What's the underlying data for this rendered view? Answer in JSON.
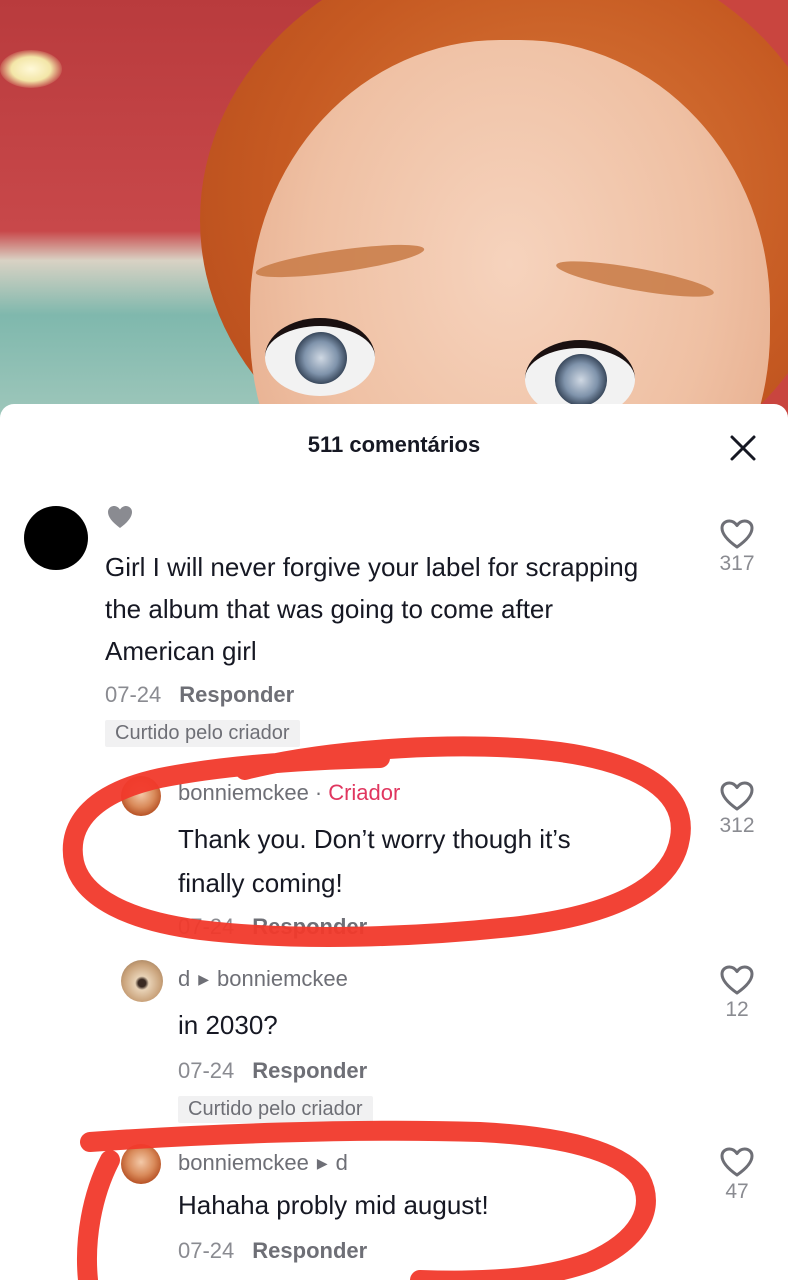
{
  "sheet": {
    "title": "511 comentários"
  },
  "comments": [
    {
      "user": "",
      "text": "Girl I will never forgive your label for scrapping the album that was going to come after American girl",
      "date": "07-24",
      "reply_label": "Responder",
      "liked_by_creator": "Curtido pelo criador",
      "likes": "317"
    },
    {
      "user": "bonniemckee",
      "separator": "·",
      "badge": "Criador",
      "text_line1": "Thank you. Don’t worry though it’s",
      "text_line2": "finally coming!",
      "date": "07-24",
      "reply_label": "Responder",
      "likes": "312"
    },
    {
      "user": "d",
      "reply_to": "bonniemckee",
      "text": "in 2030?",
      "date": "07-24",
      "reply_label": "Responder",
      "liked_by_creator": "Curtido pelo criador",
      "likes": "12"
    },
    {
      "user": "bonniemckee",
      "reply_to": "d",
      "text": "Hahaha probly mid august!",
      "date": "07-24",
      "reply_label": "Responder",
      "likes": "47"
    }
  ],
  "icons": {
    "close": "close-icon",
    "heart": "heart-outline-icon",
    "liked": "heart-filled-icon",
    "reply_arrow": "triangle-right-icon"
  },
  "colors": {
    "creator_badge": "#e0365f",
    "annotation": "#f1392b"
  }
}
